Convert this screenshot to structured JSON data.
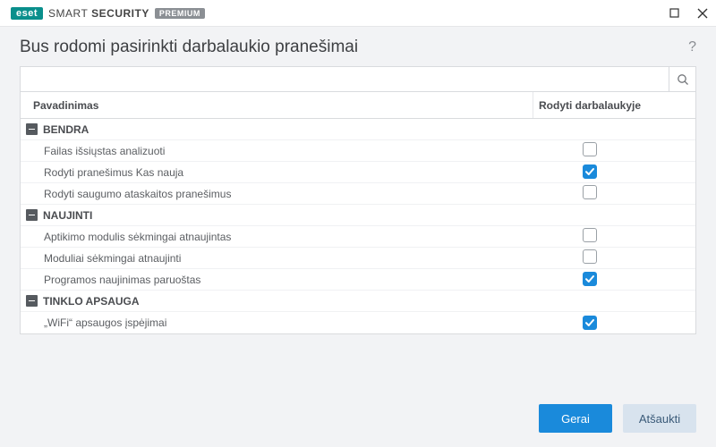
{
  "brand": {
    "eset": "eset",
    "smart": "SMART",
    "security": "SECURITY",
    "premium": "PREMIUM"
  },
  "header": {
    "title": "Bus rodomi pasirinkti darbalaukio pranešimai"
  },
  "search": {
    "placeholder": ""
  },
  "columns": {
    "name": "Pavadinimas",
    "show": "Rodyti darbalaukyje"
  },
  "groups": [
    {
      "label": "BENDRA",
      "items": [
        {
          "label": "Failas išsiųstas analizuoti",
          "checked": false
        },
        {
          "label": "Rodyti pranešimus Kas nauja",
          "checked": true
        },
        {
          "label": "Rodyti saugumo ataskaitos pranešimus",
          "checked": false
        }
      ]
    },
    {
      "label": "NAUJINTI",
      "items": [
        {
          "label": "Aptikimo modulis sėkmingai atnaujintas",
          "checked": false
        },
        {
          "label": "Moduliai sėkmingai atnaujinti",
          "checked": false
        },
        {
          "label": "Programos naujinimas paruoštas",
          "checked": true
        }
      ]
    },
    {
      "label": "TINKLO APSAUGA",
      "items": [
        {
          "label": "„WiFi“ apsaugos įspėjimai",
          "checked": true
        }
      ]
    }
  ],
  "buttons": {
    "ok": "Gerai",
    "cancel": "Atšaukti"
  }
}
